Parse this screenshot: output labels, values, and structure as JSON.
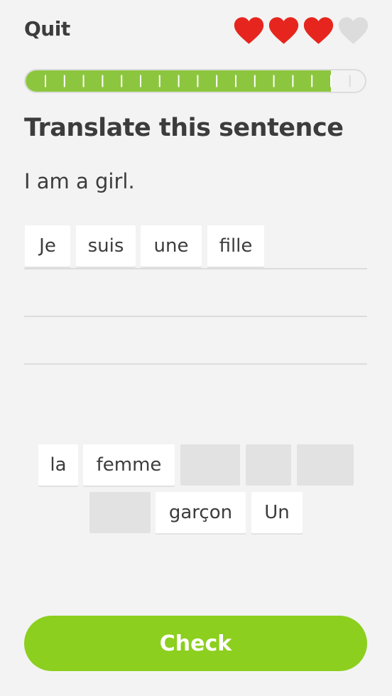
{
  "header": {
    "quit_label": "Quit",
    "hearts": [
      {
        "state": "full",
        "color": "#e6261e"
      },
      {
        "state": "full",
        "color": "#e6261e"
      },
      {
        "state": "full",
        "color": "#e6261e"
      },
      {
        "state": "empty",
        "color": "#dcdcdc"
      }
    ]
  },
  "progress": {
    "fraction": 0.9,
    "fill_color": "#8cc63e"
  },
  "exercise": {
    "title": "Translate this sentence",
    "prompt": "I am a girl."
  },
  "answer": {
    "tiles": [
      "Je",
      "suis",
      "une",
      "fille"
    ]
  },
  "word_bank": {
    "row1": [
      "la",
      "femme"
    ],
    "row2": [
      "garçon",
      "Un"
    ]
  },
  "check_button": {
    "label": "Check",
    "color": "#8ccf1f"
  }
}
